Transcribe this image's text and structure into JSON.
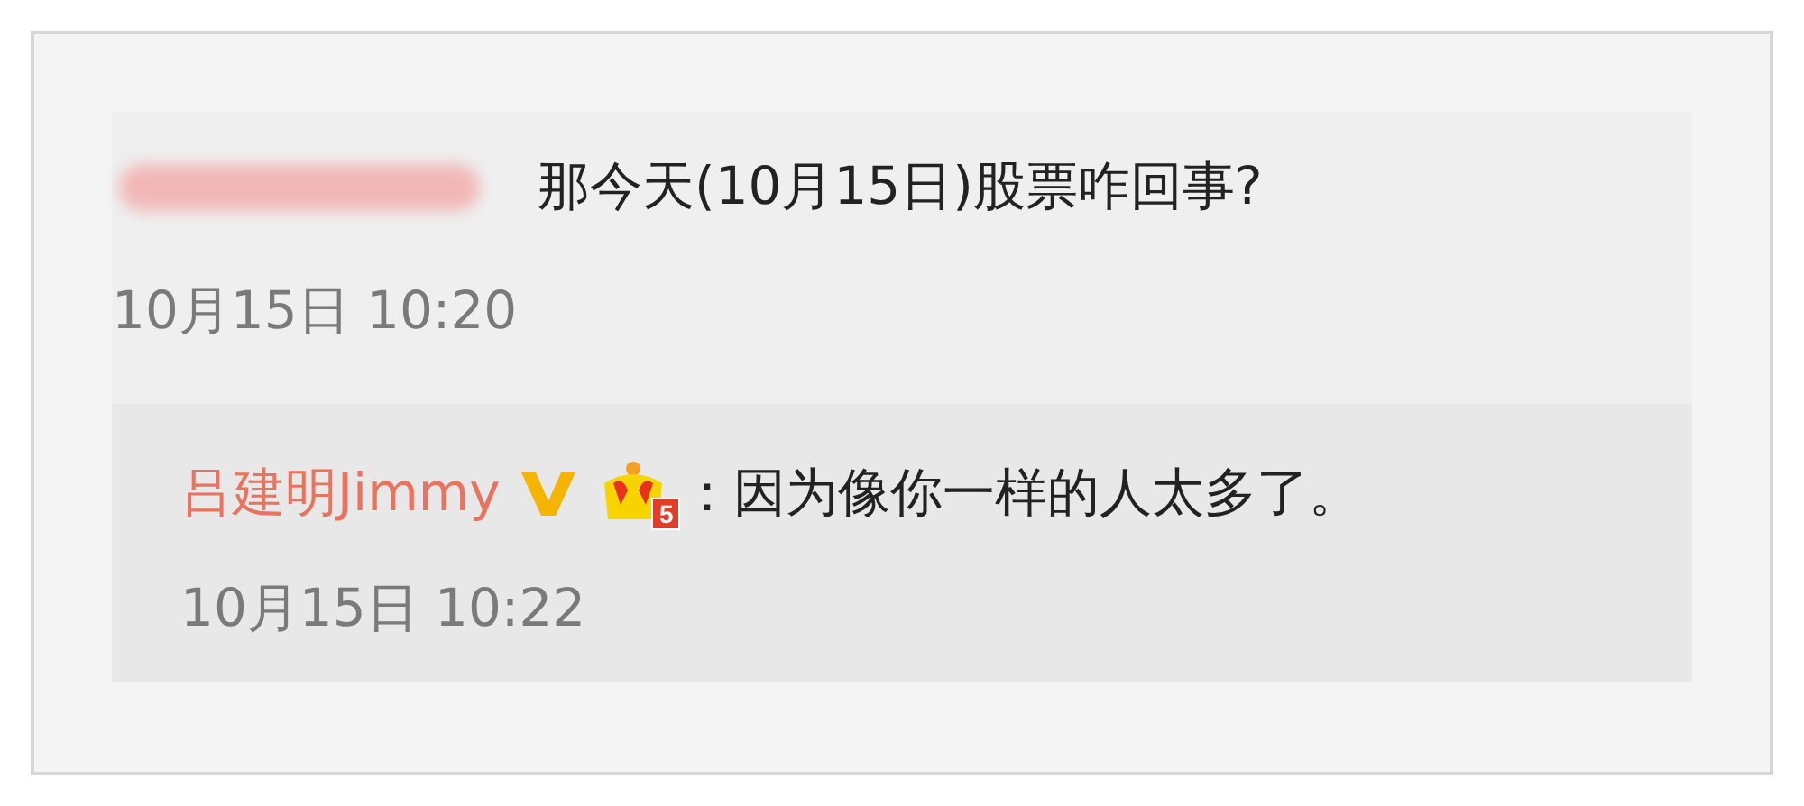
{
  "comment": {
    "text": "那今天(10月15日)股票咋回事?",
    "time": "10月15日 10:20"
  },
  "reply": {
    "author": "吕建明Jimmy",
    "verified": true,
    "level_badge": "5",
    "separator": "：",
    "text": "因为像你一样的人太多了。",
    "time": "10月15日 10:22"
  }
}
